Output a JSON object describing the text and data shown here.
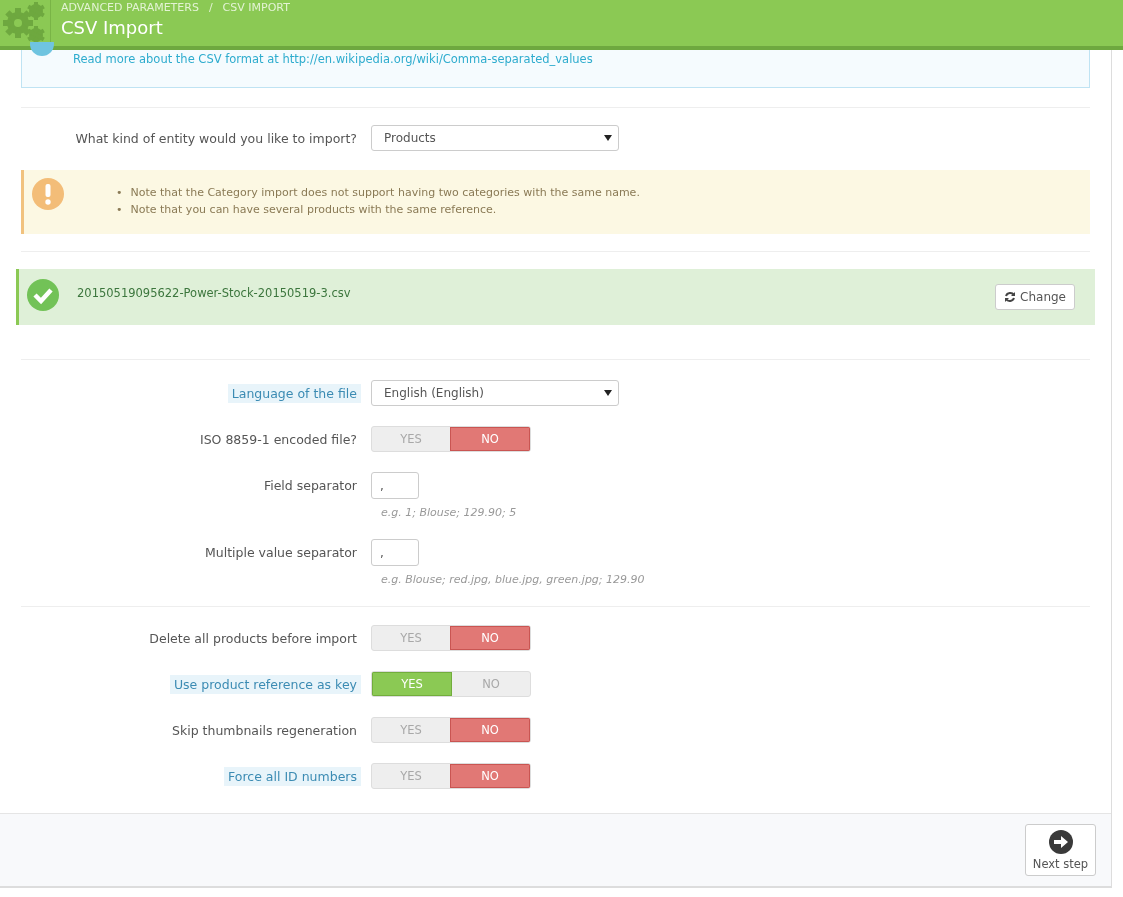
{
  "header": {
    "breadcrumb": [
      "ADVANCED PARAMETERS",
      "CSV IMPORT"
    ],
    "separator": "/",
    "title": "CSV Import"
  },
  "info": {
    "link_text": "Read more about the CSV format at http://en.wikipedia.org/wiki/Comma-separated_values"
  },
  "entity": {
    "label": "What kind of entity would you like to import?",
    "value": "Products"
  },
  "warning": {
    "bullet": "•",
    "items": [
      "Note that the Category import does not support having two categories with the same name.",
      "Note that you can have several products with the same reference."
    ]
  },
  "upload": {
    "filename": "20150519095622-Power-Stock-20150519-3.csv",
    "button": "Change"
  },
  "file_options": [
    {
      "kind": "select",
      "label": "Language of the file",
      "hint": true,
      "value": "English (English)"
    },
    {
      "kind": "switch",
      "label": "ISO 8859-1 encoded file?",
      "hint": false,
      "yes": "YES",
      "no": "NO",
      "on": false
    },
    {
      "kind": "text",
      "label": "Field separator",
      "hint": false,
      "value": ",",
      "help": "e.g. 1; Blouse; 129.90; 5"
    },
    {
      "kind": "text",
      "label": "Multiple value separator",
      "hint": false,
      "value": ",",
      "help": "e.g. Blouse; red.jpg, blue.jpg, green.jpg; 129.90"
    }
  ],
  "import_options": [
    {
      "kind": "switch",
      "label": "Delete all products before import",
      "hint": false,
      "yes": "YES",
      "no": "NO",
      "on": false
    },
    {
      "kind": "switch",
      "label": "Use product reference as key",
      "hint": true,
      "yes": "YES",
      "no": "NO",
      "on": true
    },
    {
      "kind": "switch",
      "label": "Skip thumbnails regeneration",
      "hint": false,
      "yes": "YES",
      "no": "NO",
      "on": false
    },
    {
      "kind": "switch",
      "label": "Force all ID numbers",
      "hint": true,
      "yes": "YES",
      "no": "NO",
      "on": false
    }
  ],
  "footer": {
    "button": "Next step"
  }
}
